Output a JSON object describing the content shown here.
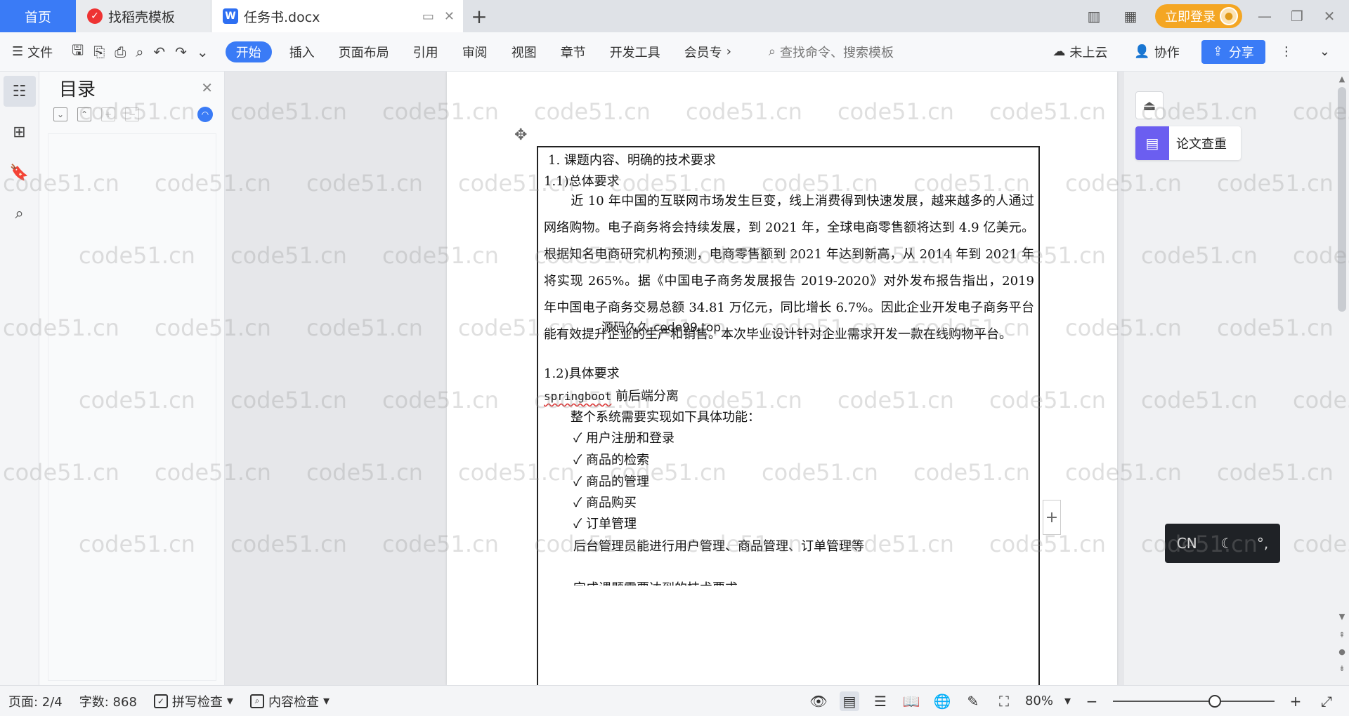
{
  "tabs": {
    "home": "首页",
    "template": "找稻壳模板",
    "doc": "任务书.docx"
  },
  "topbar": {
    "login": "立即登录"
  },
  "ribbon": {
    "file": "文件",
    "active": "开始",
    "items": [
      "插入",
      "页面布局",
      "引用",
      "审阅",
      "视图",
      "章节",
      "开发工具",
      "会员专"
    ],
    "search_placeholder": "查找命令、搜索模板",
    "cloud": "未上云",
    "collab": "协作",
    "share": "分享"
  },
  "toc": {
    "title": "目录"
  },
  "document": {
    "heading1": "1.  课题内容、明确的技术要求",
    "sub1": "1.1)总体要求",
    "para1": "近 10 年中国的互联网市场发生巨变，线上消费得到快速发展，越来越多的人通过网络购物。电子商务将会持续发展，到 2021 年，全球电商零售额将达到 4.9 亿美元。根据知名电商研究机构预测，电商零售额到 2021 年达到新高，从 2014 年到 2021 年将实现 265%。据《中国电子商务发展报告 2019-2020》对外发布报告指出，2019 年中国电子商务交易总额 34.81 万亿元，同比增长 6.7%。因此企业开发电子商务平台能有效提升企业的生产和销售。本次毕业设计针对企业需求开发一款在线购物平台。",
    "overlay_text": "源码久久-code99.top",
    "sub2": "1.2)具体要求",
    "springboot_word": "springboot",
    "springboot_rest": " 前后端分离",
    "intro": "整个系统需要实现如下具体功能：",
    "features": [
      "用户注册和登录",
      "商品的检索",
      "商品的管理",
      "商品购买",
      "订单管理"
    ],
    "admin": "后台管理员能进行用户管理、商品管理、订单管理等",
    "next": "完成课题需要达到的技术要求"
  },
  "right_panel": {
    "card_label": "论文查重",
    "ime": "CN"
  },
  "watermark": "code51.cn",
  "status": {
    "page": "页面: 2/4",
    "words": "字数: 868",
    "spell": "拼写检查",
    "content": "内容检查",
    "zoom": "80%",
    "zoom_level": 0.8
  },
  "colors": {
    "accent": "#3a7bf6",
    "login": "#f4a623",
    "check_card": "#6b5ef0"
  }
}
